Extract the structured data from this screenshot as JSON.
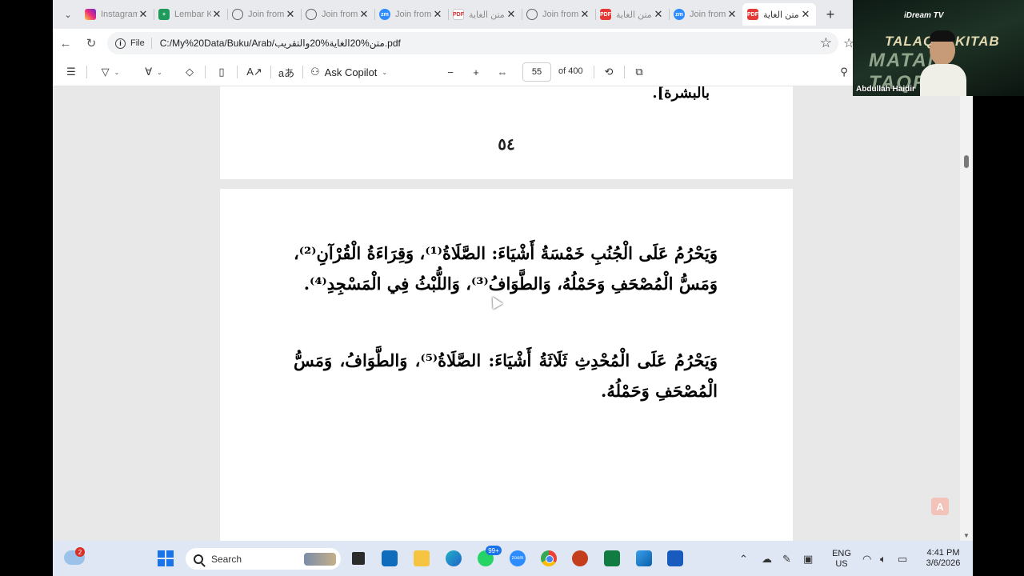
{
  "browser": {
    "tabs": [
      {
        "title": "Instagram",
        "favicon": "instagram-icon",
        "active": false
      },
      {
        "title": "Lembar Kerja",
        "favicon": "sheets-icon",
        "active": false
      },
      {
        "title": "Join from",
        "favicon": "globe-icon",
        "active": false
      },
      {
        "title": "Join from",
        "favicon": "globe-icon",
        "active": false
      },
      {
        "title": "Join from",
        "favicon": "zoom-icon",
        "active": false
      },
      {
        "title": "متن الغاية",
        "favicon": "pdf-icon",
        "active": false
      },
      {
        "title": "Join from",
        "favicon": "globe-icon",
        "active": false
      },
      {
        "title": "متن الغاية",
        "favicon": "pdf-icon",
        "active": false
      },
      {
        "title": "Join from",
        "favicon": "zoom-icon",
        "active": false
      },
      {
        "title": "متن الغاية",
        "favicon": "pdf-icon",
        "active": true
      }
    ],
    "address": {
      "chip": "File",
      "url": "C:/My%20Data/Buku/Arab/متن%20الغاية%20والتقريب.pdf"
    }
  },
  "pdf_toolbar": {
    "copilot_label": "Ask Copilot",
    "current_page": "55",
    "page_total": "of 400"
  },
  "document": {
    "page1_last_line": "بالبشرة].",
    "page1_number": "٥٤",
    "page2_paragraphs": [
      "وَيَحْرُمُ عَلَى الْجُنُبِ خَمْسَةُ أَشْيَاءَ: الصَّلَاةُ⁽¹⁾، وَقِرَاءَةُ الْقُرْآنِ⁽²⁾، وَمَسُّ الْمُصْحَفِ وَحَمْلُهُ، وَالطَّوَافُ⁽³⁾، وَاللُّبْثُ فِي الْمَسْجِدِ⁽⁴⁾.",
      "وَيَحْرُمُ عَلَى الْمُحْدِثِ ثَلَاثَةُ أَشْيَاءَ: الصَّلَاةُ⁽⁵⁾، وَالطَّوَافُ، وَمَسُّ الْمُصْحَفِ وَحَمْلُهُ."
    ]
  },
  "video_overlay": {
    "brand": "iDream TV",
    "title": "TALAQQI KITAB",
    "subtitle": "MATAN TAQRIB",
    "speaker": "Abdullah Haidir"
  },
  "taskbar": {
    "weather_badge": "2",
    "search_label": "Search",
    "whatsapp_badge": "99+",
    "zoom_label": "zoom",
    "language_line1": "ENG",
    "language_line2": "US",
    "time": "4:41 PM",
    "date": "3/6/2026"
  }
}
